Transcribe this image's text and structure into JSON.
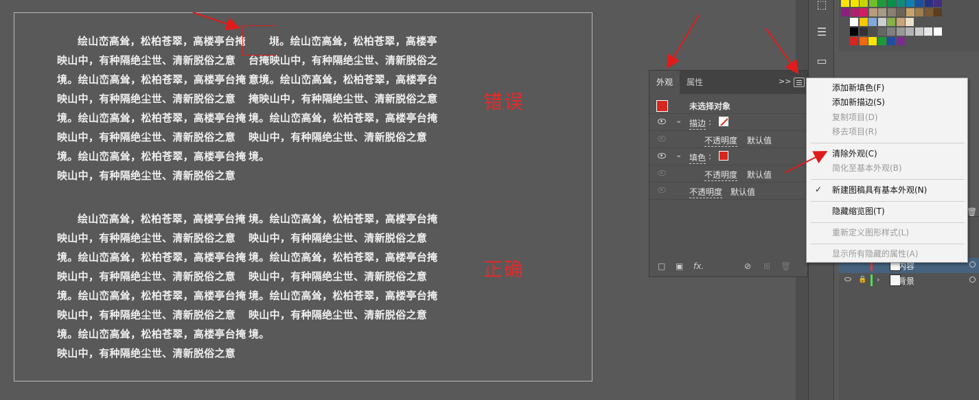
{
  "artboard": {
    "wrong_left_lines": [
      "绘山峦高耸，松柏苍翠，高楼亭台掩",
      "映山中，有种隔绝尘世、清新脱俗之意",
      "境。绘山峦高耸，松柏苍翠，高楼亭台掩",
      "映山中，有种隔绝尘世、清新脱俗之意",
      "境。绘山峦高耸，松柏苍翠，高楼亭台掩",
      "映山中，有种隔绝尘世、清新脱俗之意",
      "境。绘山峦高耸，松柏苍翠，高楼亭台掩",
      "映山中，有种隔绝尘世、清新脱俗之意"
    ],
    "wrong_right_lines": [
      "境。绘山峦高耸，松柏苍翠，高楼亭",
      "台掩映山中，有种隔绝尘世、清新脱俗之",
      "意境。绘山峦高耸，松柏苍翠，高楼亭台",
      "掩映山中，有种隔绝尘世、清新脱俗之意",
      "境。绘山峦高耸，松柏苍翠，高楼亭台掩",
      "映山中，有种隔绝尘世、清新脱俗之意",
      "境。"
    ],
    "right_left_lines": [
      "绘山峦高耸，松柏苍翠，高楼亭台掩",
      "映山中，有种隔绝尘世、清新脱俗之意",
      "境。绘山峦高耸，松柏苍翠，高楼亭台掩",
      "映山中，有种隔绝尘世、清新脱俗之意",
      "境。绘山峦高耸，松柏苍翠，高楼亭台掩",
      "映山中，有种隔绝尘世、清新脱俗之意",
      "境。绘山峦高耸，松柏苍翠，高楼亭台掩",
      "映山中，有种隔绝尘世、清新脱俗之意"
    ],
    "right_right_lines": [
      "境。绘山峦高耸，松柏苍翠，高楼亭台掩",
      "映山中，有种隔绝尘世、清新脱俗之意",
      "境。绘山峦高耸，松柏苍翠，高楼亭台掩",
      "映山中，有种隔绝尘世、清新脱俗之意",
      "境。绘山峦高耸，松柏苍翠，高楼亭台掩",
      "映山中，有种隔绝尘世、清新脱俗之意",
      "境。"
    ],
    "label_wrong": "错误",
    "label_correct": "正确",
    "accent_color": "#e12b2b"
  },
  "appearance_panel": {
    "tab_appearance": "外观",
    "tab_properties": "属性",
    "more": ">>",
    "no_selection": "未选择对象",
    "stroke_label": "描边",
    "fill_label": "填色",
    "opacity_label": "不透明度",
    "default_value": "默认值",
    "fx": "fx."
  },
  "flyout_menu": {
    "items": [
      {
        "label": "添加新填色(F)",
        "enabled": true
      },
      {
        "label": "添加新描边(S)",
        "enabled": true
      },
      {
        "label": "复制项目(D)",
        "enabled": false
      },
      {
        "label": "移去项目(R)",
        "enabled": false
      },
      {
        "label": "清除外观(C)",
        "enabled": true
      },
      {
        "label": "简化至基本外观(B)",
        "enabled": false
      },
      {
        "label": "新建图稿具有基本外观(N)",
        "enabled": true,
        "checked": true
      },
      {
        "label": "隐藏缩览图(T)",
        "enabled": true
      },
      {
        "label": "重新定义图形样式(L)",
        "enabled": false
      },
      {
        "label": "显示所有隐藏的属性(A)",
        "enabled": false
      }
    ]
  },
  "layers": [
    {
      "name": "内容",
      "selected": true,
      "color": "#e03c3c"
    },
    {
      "name": "背景",
      "selected": false,
      "color": "#4de04d"
    }
  ]
}
